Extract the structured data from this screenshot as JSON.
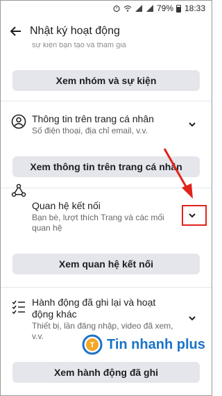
{
  "status_bar": {
    "battery_percent": "79%",
    "time": "18:33",
    "battery_level": 0.79
  },
  "header": {
    "title": "Nhật ký hoạt động"
  },
  "top_cutoff_text": "sự kiện bạn tạo và tham gia",
  "sections": {
    "groups_button": "Xem nhóm và sự kiện",
    "profile": {
      "title": "Thông tin trên trang cá nhân",
      "desc": "Số điện thoại, địa chỉ email, v.v.",
      "button": "Xem thông tin trên trang cá nhân"
    },
    "connections": {
      "title": "Quan hệ kết nối",
      "desc_line1": "Bạn bè, lượt thích Trang và các mối",
      "desc_line2": "quan hệ",
      "button": "Xem quan hệ kết nối"
    },
    "logged_actions": {
      "title_line1": "Hành động đã ghi lại và hoạt",
      "title_line2": "động khác",
      "desc_line1": "Thiết bị, lần đăng nhập, video đã xem,",
      "desc_line2": "v.v.",
      "button": "Xem hành động đã ghi"
    }
  },
  "watermark": {
    "logo_text": "Tin nhanh plus",
    "color": "#1a73c8"
  },
  "annotation_color": "#e0231b"
}
